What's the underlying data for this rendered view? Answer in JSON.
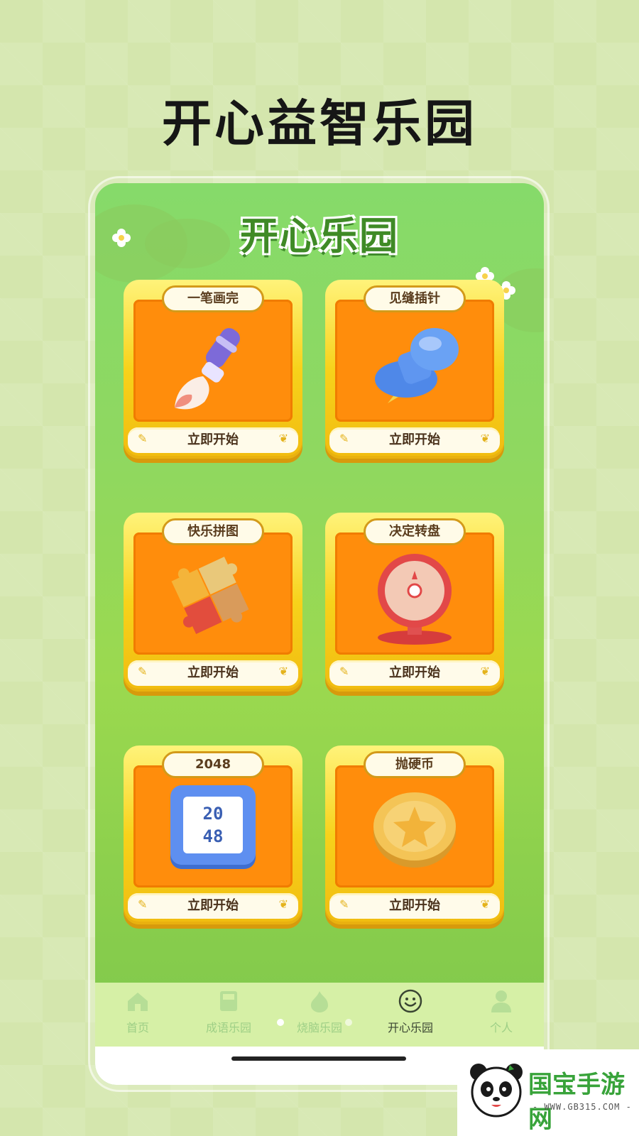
{
  "headline": "开心益智乐园",
  "app": {
    "title": "开心乐园",
    "games": [
      {
        "name": "一笔画完",
        "action": "立即开始",
        "icon": "paintbrush-icon"
      },
      {
        "name": "见缝插针",
        "action": "立即开始",
        "icon": "pushpin-icon"
      },
      {
        "name": "快乐拼图",
        "action": "立即开始",
        "icon": "puzzle-icon"
      },
      {
        "name": "决定转盘",
        "action": "立即开始",
        "icon": "spinner-wheel-icon"
      },
      {
        "name": "2048",
        "action": "立即开始",
        "icon": "tile-2048-icon",
        "tile_text_1": "20",
        "tile_text_2": "48"
      },
      {
        "name": "抛硬币",
        "action": "立即开始",
        "icon": "coin-icon"
      }
    ]
  },
  "nav": {
    "items": [
      {
        "label": "首页",
        "icon": "home-icon",
        "active": false
      },
      {
        "label": "成语乐园",
        "icon": "book-icon",
        "active": false
      },
      {
        "label": "烧脑乐园",
        "icon": "flame-icon",
        "active": false
      },
      {
        "label": "开心乐园",
        "icon": "smile-icon",
        "active": true
      },
      {
        "label": "个人",
        "icon": "person-icon",
        "active": false
      }
    ]
  },
  "watermark": {
    "brand": "国宝手游网",
    "url": "- WWW.GB315.COM -"
  },
  "colors": {
    "card_frame": "#f7d21b",
    "card_inner": "#ff8d0c",
    "app_title": "#3f8a26",
    "nav_bg": "#d6f0a6"
  }
}
